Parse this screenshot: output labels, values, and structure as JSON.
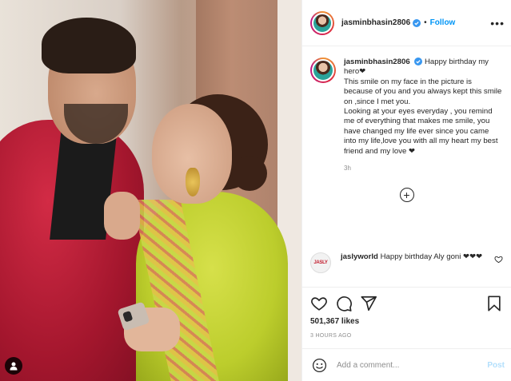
{
  "post": {
    "username": "jasminbhasin2806",
    "follow_label": "Follow",
    "more_label": "•••"
  },
  "caption": {
    "username": "jasminbhasin2806",
    "lines": [
      "Happy birthday my hero❤",
      "This smile on my face in the picture is because of you and you always kept this smile on ,since I met you.",
      "Looking at your eyes everyday , you remind me of everything that makes me smile, you have changed my life ever since you came into my life,love you with all my heart my best friend and my love ❤"
    ],
    "time": "3h"
  },
  "comment": {
    "username": "jaslyworld",
    "text": "Happy birthday Aly goni ❤❤❤",
    "avatar_text": "JASLY"
  },
  "actions": {
    "likes": "501,367 likes",
    "posted_ago": "3 HOURS AGO"
  },
  "add_comment": {
    "placeholder": "Add a comment...",
    "post_label": "Post"
  },
  "icons": {
    "verified": "verified-badge-icon",
    "heart": "heart-icon",
    "comment": "comment-icon",
    "share": "share-icon",
    "save": "bookmark-icon",
    "emoji": "emoji-icon",
    "plus": "plus-circle-icon",
    "tag": "user-tag-icon"
  },
  "colors": {
    "accent": "#0095f6",
    "post_disabled": "#b2dffc",
    "muted": "#8e8e8e",
    "text": "#262626"
  }
}
